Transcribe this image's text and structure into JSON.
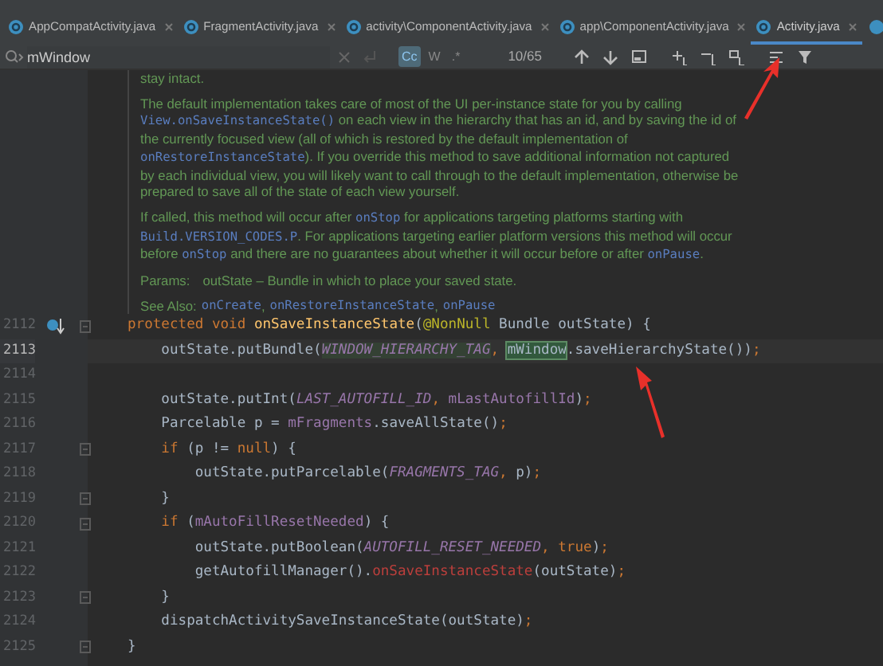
{
  "tabs": [
    {
      "label": "AppCompatActivity.java",
      "selected": false
    },
    {
      "label": "FragmentActivity.java",
      "selected": false
    },
    {
      "label": "activity\\ComponentActivity.java",
      "selected": false
    },
    {
      "label": "app\\ComponentActivity.java",
      "selected": false
    },
    {
      "label": "Activity.java",
      "selected": true
    }
  ],
  "search": {
    "value": "mWindow",
    "options": [
      {
        "label": "Cc",
        "selected": true
      },
      {
        "label": "W",
        "selected": false
      },
      {
        "label": ".*",
        "selected": false
      }
    ],
    "count": "10/65"
  },
  "doc": {
    "paragraphs": [
      [
        {
          "kind": "text",
          "text": "stay intact."
        }
      ],
      [
        {
          "kind": "text",
          "text": "The default implementation takes care of most of the UI per-instance state for you by calling "
        },
        {
          "kind": "code",
          "text": "View.onSaveInstanceState()"
        },
        {
          "kind": "text",
          "text": " on each view in the hierarchy that has an id, and by saving the id of the currently focused view (all of which is restored by the default implementation of "
        },
        {
          "kind": "code",
          "text": "onRestoreInstanceState"
        },
        {
          "kind": "text",
          "text": "). If you override this method to save additional information not captured by each individual view, you will likely want to call through to the default implementation, otherwise be prepared to save all of the state of each view yourself."
        }
      ],
      [
        {
          "kind": "text",
          "text": "If called, this method will occur after "
        },
        {
          "kind": "code",
          "text": "onStop"
        },
        {
          "kind": "text",
          "text": " for applications targeting platforms starting with "
        },
        {
          "kind": "code",
          "text": "Build.VERSION_CODES.P"
        },
        {
          "kind": "text",
          "text": ". For applications targeting earlier platform versions this method will occur before "
        },
        {
          "kind": "code",
          "text": "onStop"
        },
        {
          "kind": "text",
          "text": " and there are no guarantees about whether it will occur before or after "
        },
        {
          "kind": "code",
          "text": "onPause"
        },
        {
          "kind": "text",
          "text": "."
        }
      ]
    ],
    "params": {
      "label": "Params:",
      "text": "outState – Bundle in which to place your saved state."
    },
    "see_also": {
      "label": "See Also:",
      "links": [
        "onCreate",
        "onRestoreInstanceState",
        "onPause"
      ],
      "separator": ","
    }
  },
  "code": [
    {
      "number": "2112",
      "gutter_icon": true,
      "fold": true,
      "current": false,
      "tokens": [
        {
          "kind": "kw",
          "text": "protected void "
        },
        {
          "kind": "decl",
          "text": "onSaveInstanceState"
        },
        {
          "kind": "plain",
          "text": "("
        },
        {
          "kind": "annotation",
          "text": "@NonNull"
        },
        {
          "kind": "plain",
          "text": " Bundle outState) {"
        }
      ]
    },
    {
      "number": "2113",
      "gutter_icon": false,
      "fold": false,
      "current": true,
      "tokens": [
        {
          "kind": "plain",
          "text": "    outState.putBundle("
        },
        {
          "kind": "const_read",
          "text": "WINDOW_HIERARCHY_TAG"
        },
        {
          "kind": "kw",
          "text": ", "
        },
        {
          "kind": "match",
          "text": "mWindow"
        },
        {
          "kind": "plain",
          "text": ".saveHierarchyState())"
        },
        {
          "kind": "kw",
          "text": ";"
        }
      ]
    },
    {
      "number": "2114",
      "gutter_icon": false,
      "fold": false,
      "current": false
    },
    {
      "number": "2115",
      "gutter_icon": false,
      "fold": false,
      "current": false,
      "tokens": [
        {
          "kind": "plain",
          "text": "    outState.putInt("
        },
        {
          "kind": "const",
          "text": "LAST_AUTOFILL_ID"
        },
        {
          "kind": "kw",
          "text": ", "
        },
        {
          "kind": "field",
          "text": "mLastAutofillId"
        },
        {
          "kind": "plain",
          "text": ")"
        },
        {
          "kind": "kw",
          "text": ";"
        }
      ]
    },
    {
      "number": "2116",
      "gutter_icon": false,
      "fold": false,
      "current": false,
      "tokens": [
        {
          "kind": "plain",
          "text": "    Parcelable p = "
        },
        {
          "kind": "field",
          "text": "mFragments"
        },
        {
          "kind": "plain",
          "text": ".saveAllState()"
        },
        {
          "kind": "kw",
          "text": ";"
        }
      ]
    },
    {
      "number": "2117",
      "gutter_icon": false,
      "fold": true,
      "current": false,
      "tokens": [
        {
          "kind": "kw",
          "text": "    if "
        },
        {
          "kind": "plain",
          "text": "(p != "
        },
        {
          "kind": "kw",
          "text": "null"
        },
        {
          "kind": "plain",
          "text": ") {"
        }
      ]
    },
    {
      "number": "2118",
      "gutter_icon": false,
      "fold": false,
      "current": false,
      "tokens": [
        {
          "kind": "plain",
          "text": "        outState.putParcelable("
        },
        {
          "kind": "const",
          "text": "FRAGMENTS_TAG"
        },
        {
          "kind": "kw",
          "text": ", "
        },
        {
          "kind": "plain",
          "text": "p)"
        },
        {
          "kind": "kw",
          "text": ";"
        }
      ]
    },
    {
      "number": "2119",
      "gutter_icon": false,
      "fold": true,
      "current": false,
      "tokens": [
        {
          "kind": "plain",
          "text": "    }"
        }
      ]
    },
    {
      "number": "2120",
      "gutter_icon": false,
      "fold": true,
      "current": false,
      "tokens": [
        {
          "kind": "kw",
          "text": "    if "
        },
        {
          "kind": "plain",
          "text": "("
        },
        {
          "kind": "field",
          "text": "mAutoFillResetNeeded"
        },
        {
          "kind": "plain",
          "text": ") {"
        }
      ]
    },
    {
      "number": "2121",
      "gutter_icon": false,
      "fold": false,
      "current": false,
      "tokens": [
        {
          "kind": "plain",
          "text": "        outState.putBoolean("
        },
        {
          "kind": "const",
          "text": "AUTOFILL_RESET_NEEDED"
        },
        {
          "kind": "kw",
          "text": ", true"
        },
        {
          "kind": "plain",
          "text": ")"
        },
        {
          "kind": "kw",
          "text": ";"
        }
      ]
    },
    {
      "number": "2122",
      "gutter_icon": false,
      "fold": false,
      "current": false,
      "tokens": [
        {
          "kind": "plain",
          "text": "        getAutofillManager()."
        },
        {
          "kind": "error",
          "text": "onSaveInstanceState"
        },
        {
          "kind": "plain",
          "text": "(outState)"
        },
        {
          "kind": "kw",
          "text": ";"
        }
      ]
    },
    {
      "number": "2123",
      "gutter_icon": false,
      "fold": true,
      "current": false,
      "tokens": [
        {
          "kind": "plain",
          "text": "    }"
        }
      ]
    },
    {
      "number": "2124",
      "gutter_icon": false,
      "fold": false,
      "current": false,
      "tokens": [
        {
          "kind": "plain",
          "text": "    dispatchActivitySaveInstanceState(outState)"
        },
        {
          "kind": "kw",
          "text": ";"
        }
      ]
    },
    {
      "number": "2125",
      "gutter_icon": false,
      "fold": true,
      "current": false,
      "tokens": [
        {
          "kind": "plain",
          "text": "}"
        }
      ]
    }
  ]
}
